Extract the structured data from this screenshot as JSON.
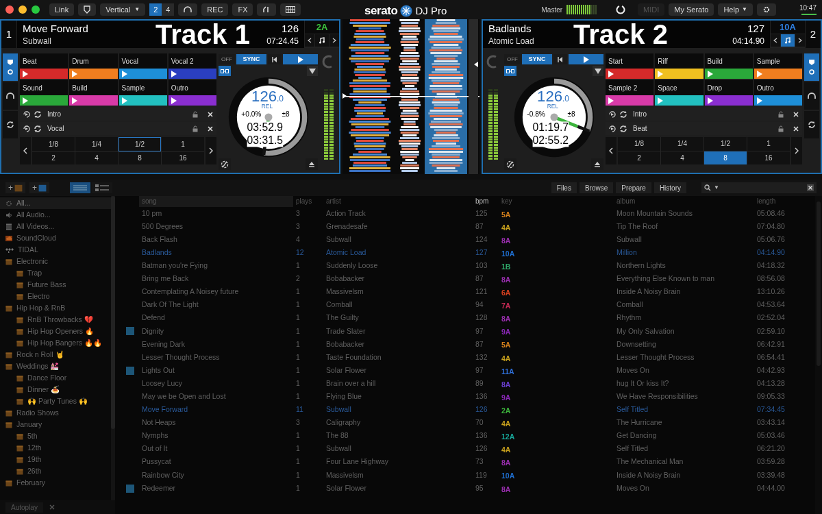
{
  "toolbar": {
    "link": "Link",
    "layout": "Vertical",
    "layout_caret": "▼",
    "help_caret": "▼",
    "deck_counts": [
      {
        "label": "2",
        "selected": true
      },
      {
        "label": "4",
        "selected": false
      }
    ],
    "rec": "REC",
    "fx": "FX",
    "logo": "serato",
    "logo_suffix": "DJ Pro",
    "master": "Master",
    "midi": {
      "label": "MIDI",
      "disabled": true
    },
    "my_serato": "My Serato",
    "help": "Help",
    "clock": "10:47"
  },
  "decks": [
    {
      "number": "1",
      "title": "Move Forward",
      "artist": "Subwall",
      "overlay_label": "Track 1",
      "bpm": "126",
      "time": "07:24.45",
      "key": {
        "text": "2A",
        "color": "#3cc43c"
      },
      "key_lock": false,
      "off": "OFF",
      "sync": "SYNC",
      "platter": {
        "bpm": "126",
        "bpm_decimal": ".0",
        "rel": "REL",
        "pitch": "+0.0%",
        "range": "±8",
        "elapsed": "03:52.9",
        "remaining": "03:31.5",
        "level": 0.52
      },
      "cues": [
        {
          "label": "Beat",
          "color": "#d42a2a"
        },
        {
          "label": "Drum",
          "color": "#f07e1f"
        },
        {
          "label": "Vocal",
          "color": "#1e8fd8"
        },
        {
          "label": "Vocal 2",
          "color": "#2a3fc0"
        },
        {
          "label": "Sound",
          "color": "#2aa83a"
        },
        {
          "label": "Build",
          "color": "#d83aa8"
        },
        {
          "label": "Sample",
          "color": "#22c0c0"
        },
        {
          "label": "Outro",
          "color": "#8a2ed0"
        }
      ],
      "loops": [
        {
          "label": "Intro"
        },
        {
          "label": "Vocal"
        }
      ],
      "loop_sizes": [
        {
          "label": "1/8",
          "selected": false,
          "focused": false
        },
        {
          "label": "1/4",
          "selected": false,
          "focused": false
        },
        {
          "label": "1/2",
          "selected": false,
          "focused": true
        },
        {
          "label": "1",
          "selected": false,
          "focused": false
        },
        {
          "label": "2",
          "selected": false,
          "focused": false
        },
        {
          "label": "4",
          "selected": false,
          "focused": false
        },
        {
          "label": "8",
          "selected": false,
          "focused": false
        },
        {
          "label": "16",
          "selected": false,
          "focused": false
        }
      ]
    },
    {
      "number": "2",
      "title": "Badlands",
      "artist": "Atomic Load",
      "overlay_label": "Track 2",
      "bpm": "127",
      "time": "04:14.90",
      "key": {
        "text": "10A",
        "color": "#2f7fe0"
      },
      "key_lock": true,
      "off": "OFF",
      "sync": "SYNC",
      "platter": {
        "bpm": "126",
        "bpm_decimal": ".0",
        "rel": "REL",
        "pitch": "-0.8%",
        "range": "±8",
        "elapsed": "01:19.7",
        "remaining": "02:55.2",
        "level": 0.31
      },
      "cues": [
        {
          "label": "Start",
          "color": "#d42a2a"
        },
        {
          "label": "Riff",
          "color": "#f0c020"
        },
        {
          "label": "Build",
          "color": "#2aa83a"
        },
        {
          "label": "Sample",
          "color": "#f07e1f"
        },
        {
          "label": "Sample 2",
          "color": "#d83aa8"
        },
        {
          "label": "Space",
          "color": "#22c0c0"
        },
        {
          "label": "Drop",
          "color": "#8a2ed0"
        },
        {
          "label": "Outro",
          "color": "#1e8fd8"
        }
      ],
      "loops": [
        {
          "label": "Intro"
        },
        {
          "label": "Beat"
        }
      ],
      "loop_sizes": [
        {
          "label": "1/8",
          "selected": false,
          "focused": false
        },
        {
          "label": "1/4",
          "selected": false,
          "focused": false
        },
        {
          "label": "1/2",
          "selected": false,
          "focused": false
        },
        {
          "label": "1",
          "selected": false,
          "focused": false
        },
        {
          "label": "2",
          "selected": false,
          "focused": false
        },
        {
          "label": "4",
          "selected": false,
          "focused": false
        },
        {
          "label": "8",
          "selected": true,
          "focused": false
        },
        {
          "label": "16",
          "selected": false,
          "focused": false
        }
      ]
    }
  ],
  "library": {
    "add_crate": "+",
    "add_smart_crate": "+",
    "search_caret": "▼",
    "views": [
      {
        "kind": "list",
        "selected": true
      },
      {
        "kind": "artwork",
        "selected": false
      }
    ],
    "tabs": [
      "Files",
      "Browse",
      "Prepare",
      "History"
    ],
    "sidebar": [
      {
        "kind": "all",
        "label": "All...",
        "selected": true
      },
      {
        "kind": "audio",
        "label": "All Audio...",
        "selected": false
      },
      {
        "kind": "video",
        "label": "All Videos...",
        "selected": false
      },
      {
        "kind": "soundcloud",
        "label": "SoundCloud",
        "selected": false
      },
      {
        "kind": "tidal",
        "label": "TIDAL",
        "selected": false
      },
      {
        "kind": "crate",
        "label": "Electronic",
        "selected": false,
        "children": [
          {
            "kind": "crate",
            "label": "Trap",
            "selected": false
          },
          {
            "kind": "crate",
            "label": "Future Bass",
            "selected": false
          },
          {
            "kind": "crate",
            "label": "Electro",
            "selected": false
          }
        ]
      },
      {
        "kind": "crate",
        "label": "Hip Hop & RnB",
        "selected": false,
        "children": [
          {
            "kind": "crate",
            "label": "RnB Throwbacks 💔",
            "selected": false
          },
          {
            "kind": "crate",
            "label": "Hip Hop Openers 🔥",
            "selected": false
          },
          {
            "kind": "crate",
            "label": "Hip Hop Bangers 🔥🔥",
            "selected": false
          }
        ]
      },
      {
        "kind": "crate",
        "label": "Rock n Roll 🤘",
        "selected": false
      },
      {
        "kind": "crate",
        "label": "Weddings 💒",
        "selected": false,
        "children": [
          {
            "kind": "crate",
            "label": "Dance Floor",
            "selected": false
          },
          {
            "kind": "crate",
            "label": "Dinner 🍝",
            "selected": false
          },
          {
            "kind": "crate",
            "label": "🙌 Party Tunes 🙌",
            "selected": false
          }
        ]
      },
      {
        "kind": "crate",
        "label": "Radio Shows",
        "selected": false
      },
      {
        "kind": "crate",
        "label": "January",
        "selected": false,
        "children": [
          {
            "kind": "crate",
            "label": "5th",
            "selected": false
          },
          {
            "kind": "crate",
            "label": "12th",
            "selected": false
          },
          {
            "kind": "crate",
            "label": "19th",
            "selected": false
          },
          {
            "kind": "crate",
            "label": "26th",
            "selected": false
          }
        ]
      },
      {
        "kind": "crate",
        "label": "February",
        "selected": false
      }
    ],
    "autoplay": "Autoplay",
    "columns": [
      "song",
      "plays",
      "artist",
      "bpm",
      "key",
      "album",
      "length"
    ],
    "rows": [
      {
        "song": "10 pm",
        "plays": "3",
        "artist": "Action Track",
        "bpm": "125",
        "key": {
          "text": "5A",
          "color": "#d4801c"
        },
        "album": "Moon Mountain Sounds",
        "length": "05:08.46",
        "loaded": false,
        "flagged": false
      },
      {
        "song": "500 Degrees",
        "plays": "3",
        "artist": "Grenadesafe",
        "bpm": "87",
        "key": {
          "text": "4A",
          "color": "#c9a21d"
        },
        "album": "Tip The Roof",
        "length": "07:04.80",
        "loaded": false,
        "flagged": false
      },
      {
        "song": "Back Flash",
        "plays": "4",
        "artist": "Subwall",
        "bpm": "124",
        "key": {
          "text": "8A",
          "color": "#9b2fb0"
        },
        "album": "Subwall",
        "length": "05:06.76",
        "loaded": false,
        "flagged": false
      },
      {
        "song": "Badlands",
        "plays": "12",
        "artist": "Atomic Load",
        "bpm": "127",
        "key": {
          "text": "10A",
          "color": "#1f6fd0"
        },
        "album": "Million",
        "length": "04:14.90",
        "loaded": true,
        "flagged": false
      },
      {
        "song": "Batman you're Fying",
        "plays": "1",
        "artist": "Suddenly Loose",
        "bpm": "103",
        "key": {
          "text": "1B",
          "color": "#2fa86a"
        },
        "album": "Northern Lights",
        "length": "04:18.32",
        "loaded": false,
        "flagged": false
      },
      {
        "song": "Bring me Back",
        "plays": "2",
        "artist": "Bobabacker",
        "bpm": "87",
        "key": {
          "text": "8A",
          "color": "#9b2fb0"
        },
        "album": "Everything Else Known to man",
        "length": "08:56.08",
        "loaded": false,
        "flagged": false
      },
      {
        "song": "Contemplating A Noisey future",
        "plays": "1",
        "artist": "Massivelsm",
        "bpm": "121",
        "key": {
          "text": "6A",
          "color": "#d8401f"
        },
        "album": "Inside A Noisy Brain",
        "length": "13:10.26",
        "loaded": false,
        "flagged": false
      },
      {
        "song": "Dark Of The Light",
        "plays": "1",
        "artist": "Comball",
        "bpm": "94",
        "key": {
          "text": "7A",
          "color": "#c82a55"
        },
        "album": "Comball",
        "length": "04:53.64",
        "loaded": false,
        "flagged": false
      },
      {
        "song": "Defend",
        "plays": "1",
        "artist": "The Guilty",
        "bpm": "128",
        "key": {
          "text": "8A",
          "color": "#9b2fb0"
        },
        "album": "Rhythm",
        "length": "02:52.04",
        "loaded": false,
        "flagged": false
      },
      {
        "song": "Dignity",
        "plays": "1",
        "artist": "Trade Slater",
        "bpm": "97",
        "key": {
          "text": "9A",
          "color": "#8a28b8"
        },
        "album": "My Only Salvation",
        "length": "02:59.10",
        "loaded": false,
        "flagged": true
      },
      {
        "song": "Evening Dark",
        "plays": "1",
        "artist": "Bobabacker",
        "bpm": "87",
        "key": {
          "text": "5A",
          "color": "#d4801c"
        },
        "album": "Downsetting",
        "length": "06:42.91",
        "loaded": false,
        "flagged": false
      },
      {
        "song": "Lesser Thought Process",
        "plays": "1",
        "artist": "Taste Foundation",
        "bpm": "132",
        "key": {
          "text": "4A",
          "color": "#c9a21d"
        },
        "album": "Lesser Thought Process",
        "length": "06:54.41",
        "loaded": false,
        "flagged": false
      },
      {
        "song": "Lights Out",
        "plays": "1",
        "artist": "Solar Flower",
        "bpm": "97",
        "key": {
          "text": "11A",
          "color": "#2f6fd8"
        },
        "album": "Moves On",
        "length": "04:42.93",
        "loaded": false,
        "flagged": true
      },
      {
        "song": "Loosey Lucy",
        "plays": "1",
        "artist": "Brain over a hill",
        "bpm": "89",
        "key": {
          "text": "8A",
          "color": "#6a3fd0"
        },
        "album": "hug It Or kiss It?",
        "length": "04:13.28",
        "loaded": false,
        "flagged": false
      },
      {
        "song": "May we be Open and Lost",
        "plays": "1",
        "artist": "Flying Blue",
        "bpm": "136",
        "key": {
          "text": "9A",
          "color": "#8a28b8"
        },
        "album": "We Have Responsibilities",
        "length": "09:05.33",
        "loaded": false,
        "flagged": false
      },
      {
        "song": "Move Forward",
        "plays": "11",
        "artist": "Subwall",
        "bpm": "126",
        "key": {
          "text": "2A",
          "color": "#3cb43c"
        },
        "album": "Self Titled",
        "length": "07:34.45",
        "loaded": true,
        "flagged": false
      },
      {
        "song": "Not Heaps",
        "plays": "3",
        "artist": "Caligraphy",
        "bpm": "70",
        "key": {
          "text": "4A",
          "color": "#c9a21d"
        },
        "album": "The Hurricane",
        "length": "03:43.14",
        "loaded": false,
        "flagged": false
      },
      {
        "song": "Nymphs",
        "plays": "1",
        "artist": "The 88",
        "bpm": "136",
        "key": {
          "text": "12A",
          "color": "#18a79a"
        },
        "album": "Get Dancing",
        "length": "05:03.46",
        "loaded": false,
        "flagged": false
      },
      {
        "song": "Out of It",
        "plays": "1",
        "artist": "Subwall",
        "bpm": "126",
        "key": {
          "text": "4A",
          "color": "#c9a21d"
        },
        "album": "Self Titled",
        "length": "06:21.20",
        "loaded": false,
        "flagged": false
      },
      {
        "song": "Pussycat",
        "plays": "1",
        "artist": "Four Lane Highway",
        "bpm": "73",
        "key": {
          "text": "8A",
          "color": "#9b2fb0"
        },
        "album": "The Mechanical Man",
        "length": "03:59.28",
        "loaded": false,
        "flagged": false
      },
      {
        "song": "Rainbow City",
        "plays": "1",
        "artist": "Massivelsm",
        "bpm": "119",
        "key": {
          "text": "10A",
          "color": "#1f6fd0"
        },
        "album": "Inside A Noisy Brain",
        "length": "03:39.48",
        "loaded": false,
        "flagged": false
      },
      {
        "song": "Redeemer",
        "plays": "1",
        "artist": "Solar Flower",
        "bpm": "95",
        "key": {
          "text": "8A",
          "color": "#9b2fb0"
        },
        "album": "Moves On",
        "length": "04:44.00",
        "loaded": false,
        "flagged": true
      }
    ]
  }
}
